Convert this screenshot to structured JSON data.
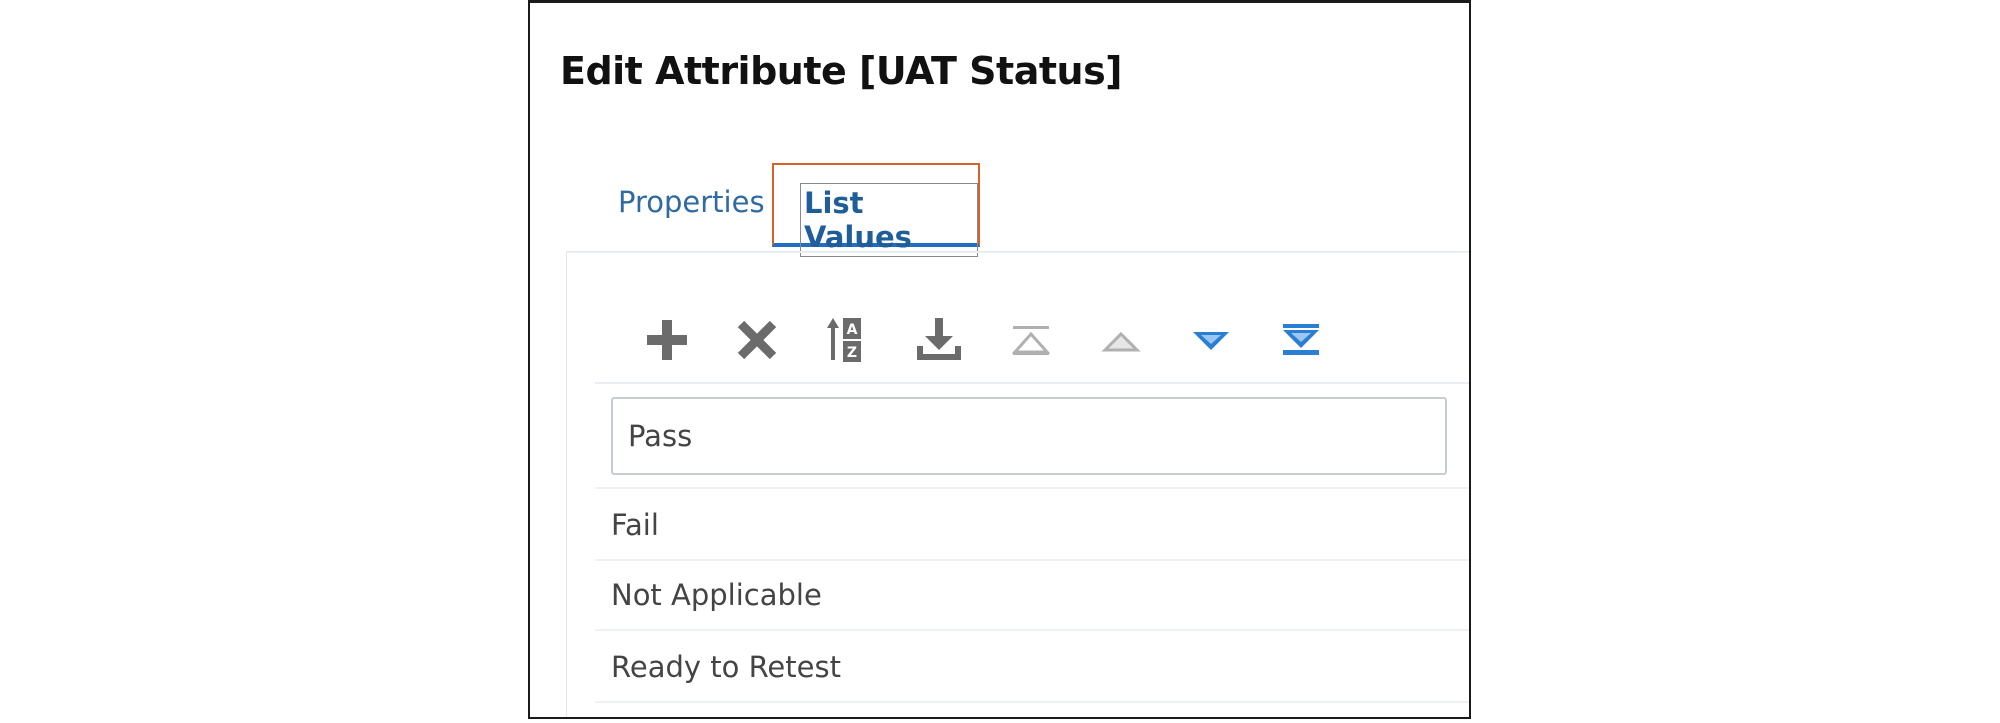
{
  "dialog": {
    "title": "Edit Attribute [UAT Status]"
  },
  "tabs": [
    {
      "label": "Properties",
      "selected": false
    },
    {
      "label": "List Values",
      "selected": true
    }
  ],
  "toolbar": {
    "icons": [
      "add-icon",
      "delete-icon",
      "sort-icon",
      "import-icon",
      "move-to-top-icon",
      "move-up-icon",
      "move-down-icon",
      "move-to-bottom-icon"
    ]
  },
  "list": {
    "editing_value": "Pass",
    "items": [
      {
        "label": "Fail"
      },
      {
        "label": "Not Applicable"
      },
      {
        "label": "Ready to Retest"
      }
    ]
  },
  "colors": {
    "tab_text": "#2f6aa3",
    "tab_selected_highlight": "#d4622a",
    "tab_underline": "#1f6fc5",
    "icon_gray": "#6b6b6b",
    "icon_blue": "#2a7fd4",
    "icon_disabled": "#b0b0b0"
  }
}
